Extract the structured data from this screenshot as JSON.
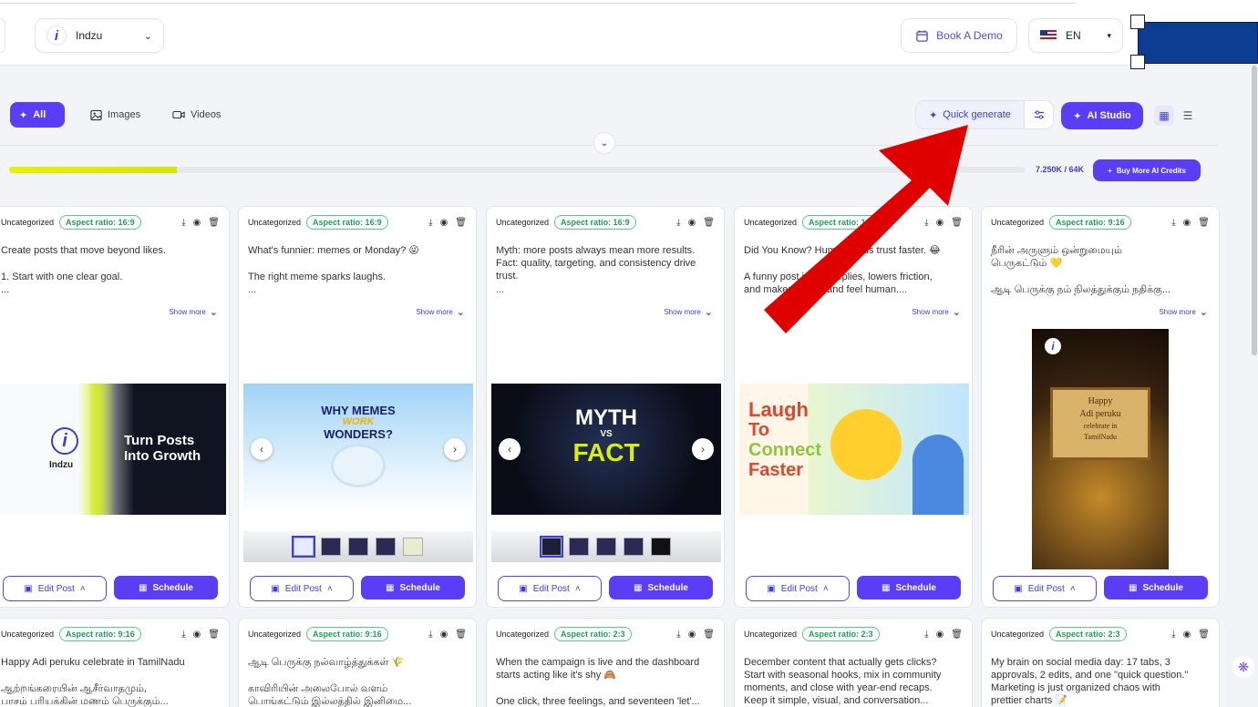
{
  "header": {
    "workspace_name": "Indzu",
    "workspace_logo": "i",
    "book_demo": "Book A Demo",
    "language": "EN"
  },
  "filters": [
    {
      "label": "All",
      "icon": "sparkle-icon",
      "active": true
    },
    {
      "label": "Images",
      "icon": "image-icon",
      "active": false
    },
    {
      "label": "Videos",
      "icon": "video-icon",
      "active": false
    }
  ],
  "toolbar": {
    "quick_generate": "Quick generate",
    "ai_studio": "AI Studio"
  },
  "credits": {
    "used_fraction": 0.165,
    "text": "7.250K / 64K",
    "buy_label": "Buy More AI Credits"
  },
  "cards_row1": [
    {
      "category": "Uncategorized",
      "aspect": "Aspect ratio: 16:9",
      "line1": "Create posts that move beyond likes.",
      "line2": "1. Start with one clear goal.",
      "line3": "...",
      "show_more": "Show more",
      "edit": "Edit Post",
      "schedule": "Schedule",
      "art_text": "Turn Posts",
      "art_text2": "Into Growth",
      "brand": "Indzu"
    },
    {
      "category": "Uncategorized",
      "aspect": "Aspect ratio: 16:9",
      "line1": "What's funnier: memes or Monday? 😜",
      "line2": "The right meme sparks laughs.",
      "line3": "...",
      "show_more": "Show more",
      "edit": "Edit Post",
      "schedule": "Schedule",
      "art_text": "WHY MEMES",
      "art_text2": "WORK",
      "art_text3": "WONDERS?"
    },
    {
      "category": "Uncategorized",
      "aspect": "Aspect ratio: 16:9",
      "line1": "Myth: more posts always mean more results.",
      "line1b": "Fact: quality, targeting, and consistency drive",
      "line2": "trust.",
      "line3": "...",
      "show_more": "Show more",
      "edit": "Edit Post",
      "schedule": "Schedule",
      "art_text": "MYTH",
      "art_text2": "VS",
      "art_text3": "FACT"
    },
    {
      "category": "Uncategorized",
      "aspect": "Aspect ratio: 16:9",
      "line1": "Did You Know? Humor builds trust faster. 😂",
      "line2": "A funny post invites replies, lowers friction,",
      "line2b": "and makes your brand feel human....",
      "show_more": "Show more",
      "edit": "Edit Post",
      "schedule": "Schedule",
      "art_text": "Laugh",
      "art_text2": "To",
      "art_text3": "Connect",
      "art_text4": "Faster"
    },
    {
      "category": "Uncategorized",
      "aspect": "Aspect ratio: 9:16",
      "line1": "நீரின் அருளும் ஒன்றுமையும்",
      "line1b": "பெருகட்டும் 💛",
      "line2": "ஆடி பெருக்கு நம் நிலத்துக்கும் நதிக்கு...",
      "show_more": "Show more",
      "edit": "Edit Post",
      "schedule": "Schedule",
      "art_text": "Happy",
      "art_text2": "Adi peruku",
      "art_text3": "celebrate in",
      "art_text4": "TamilNadu"
    }
  ],
  "cards_row2": [
    {
      "category": "Uncategorized",
      "aspect": "Aspect ratio: 9:16",
      "line1": "Happy Adi peruku celebrate in TamilNadu",
      "line2": "ஆற்றங்கரையின் ஆசீர்வாதமும்,",
      "line3": "பாசம் பரியக்கின் மணம் பெருக்கும்..."
    },
    {
      "category": "Uncategorized",
      "aspect": "Aspect ratio: 9:16",
      "line1": "ஆடி பெருக்கு நல்வாழ்த்துக்கள் 🌾",
      "line2": "காவிரியின் அலைபோல் வளம்",
      "line3": "பொங்கட்டும் இல்லத்தில் இனிமை..."
    },
    {
      "category": "Uncategorized",
      "aspect": "Aspect ratio: 2:3",
      "line1": "When the campaign is live and the dashboard",
      "line2": "starts acting like it's shy 🙈",
      "line3": "One click, three feelings, and seventeen 'let'..."
    },
    {
      "category": "Uncategorized",
      "aspect": "Aspect ratio: 2:3",
      "line1": "December content that actually gets clicks?",
      "line2": "Start with seasonal hooks, mix in community",
      "line3": "moments, and close with year-end recaps.",
      "line4": "Keep it simple, visual, and conversation..."
    },
    {
      "category": "Uncategorized",
      "aspect": "Aspect ratio: 2:3",
      "line1": "My brain on social media day: 17 tabs, 3",
      "line2": "approvals, 2 edits, and one \"quick question.\"",
      "line3": "Marketing is just organized chaos with",
      "line4": "prettier charts 📝"
    }
  ],
  "colors": {
    "accent": "#5b3df5",
    "accent_text": "#3b3fd8",
    "aspect_green": "#1f9f5a",
    "annotation_red": "#e00000"
  }
}
